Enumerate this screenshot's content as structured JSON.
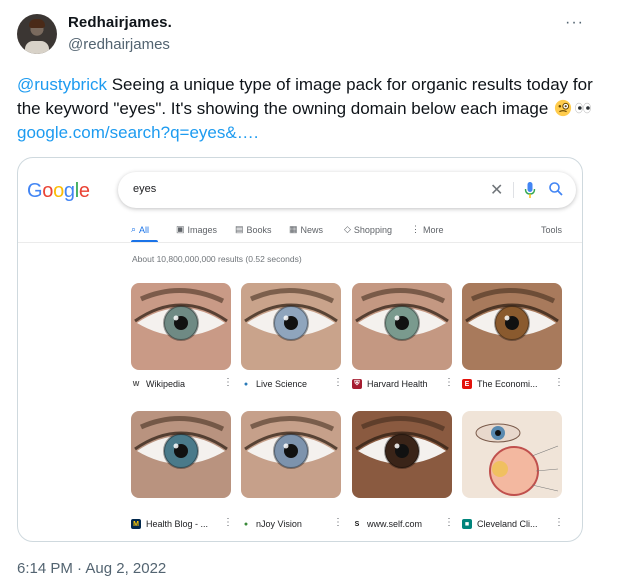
{
  "tweet": {
    "author_name": "Redhairjames.",
    "author_handle": "@redhairjames",
    "more_label": "···",
    "mention": "@rustybrick",
    "text_body": " Seeing a unique type of image pack for organic results today for the keyword \"eyes\". It's showing the owning domain below each image ",
    "link": "google.com/search?q=eyes&….",
    "timestamp": "6:14 PM · Aug 2, 2022"
  },
  "google": {
    "logo_letters": [
      "G",
      "o",
      "o",
      "g",
      "l",
      "e"
    ],
    "logo_colors": [
      "#4285f4",
      "#ea4335",
      "#fbbc05",
      "#4285f4",
      "#34a853",
      "#ea4335"
    ],
    "query": "eyes",
    "clear_icon": "close-icon",
    "tabs": [
      {
        "icon": "search-icon",
        "glyph": "⌕",
        "label": "All",
        "active": true
      },
      {
        "icon": "image-icon",
        "glyph": "▣",
        "label": "Images"
      },
      {
        "icon": "book-icon",
        "glyph": "▤",
        "label": "Books"
      },
      {
        "icon": "news-icon",
        "glyph": "▦",
        "label": "News"
      },
      {
        "icon": "tag-icon",
        "glyph": "◇",
        "label": "Shopping"
      },
      {
        "icon": "more-icon",
        "glyph": "⋮",
        "label": "More"
      }
    ],
    "tools_label": "Tools",
    "result_stats": "About 10,800,000,000 results (0.52 seconds)",
    "accent": "#1a73e8",
    "images": [
      {
        "source": "Wikipedia",
        "favicon": "W",
        "favicon_color": "#ffffff",
        "favicon_text": "#555555",
        "iris": "#6f8a84",
        "skin": "#c99a86"
      },
      {
        "source": "Live Science",
        "favicon": "●",
        "favicon_color": "#ffffff",
        "favicon_text": "#2a7ab8",
        "iris": "#8fa5bd",
        "skin": "#c9a38b"
      },
      {
        "source": "Harvard Health",
        "favicon": "⛨",
        "favicon_color": "#a51c30",
        "favicon_text": "#ffffff",
        "iris": "#7a9a8e",
        "skin": "#c49882"
      },
      {
        "source": "The Economi...",
        "favicon": "E",
        "favicon_color": "#e3120b",
        "favicon_text": "#ffffff",
        "iris": "#8a5a2e",
        "skin": "#a87a5c"
      },
      {
        "source": "Health Blog - ...",
        "favicon": "M",
        "favicon_color": "#00274c",
        "favicon_text": "#ffcb05",
        "iris": "#4a7a8a",
        "skin": "#b9937f"
      },
      {
        "source": "nJoy Vision",
        "favicon": "●",
        "favicon_color": "#ffffff",
        "favicon_text": "#3a8a3a",
        "iris": "#7d93ad",
        "skin": "#c6a08a"
      },
      {
        "source": "www.self.com",
        "favicon": "S",
        "favicon_color": "#ffffff",
        "favicon_text": "#111111",
        "iris": "#3a2418",
        "skin": "#8a5a40"
      },
      {
        "source": "Cleveland Cli...",
        "favicon": "■",
        "favicon_color": "#00857c",
        "favicon_text": "#ffffff",
        "iris": "#5a8ab0",
        "skin": "#f0e4d8"
      }
    ]
  }
}
